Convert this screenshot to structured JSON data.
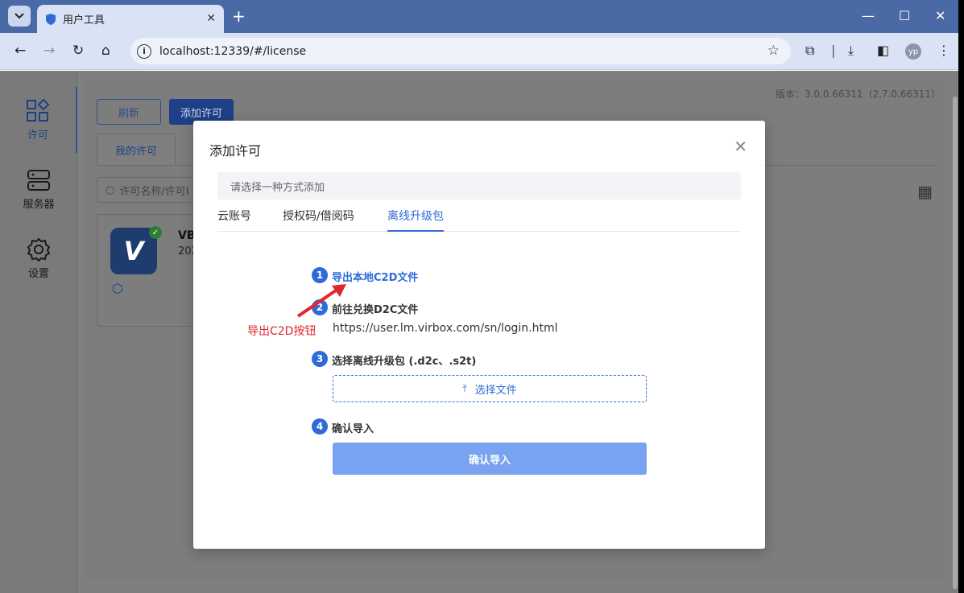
{
  "browser": {
    "tab_title": "用户工具",
    "url": "localhost:12339/#/license",
    "avatar_initials": "yp"
  },
  "sidebar": {
    "items": [
      {
        "label": "许可",
        "icon": "apps-grid-icon"
      },
      {
        "label": "服务器",
        "icon": "server-icon"
      },
      {
        "label": "设置",
        "icon": "gear-icon"
      }
    ]
  },
  "main": {
    "version": "版本：3.0.0.66311（2.7.0.66311）",
    "refresh_label": "刷新",
    "add_license_label": "添加许可",
    "tab_my_license": "我的许可",
    "search_placeholder": "许可名称/许可I",
    "card": {
      "name": "VB",
      "sub": "202",
      "logo_letter": "V"
    }
  },
  "modal": {
    "title": "添加许可",
    "banner": "请选择一种方式添加",
    "tabs": [
      "云账号",
      "授权码/借阅码",
      "离线升级包"
    ],
    "active_tab": "离线升级包",
    "steps": [
      {
        "num": "1",
        "label": "导出本地C2D文件"
      },
      {
        "num": "2",
        "label": "前往兑换D2C文件"
      },
      {
        "num": "3",
        "label": "选择离线升级包 (.d2c、.s2t)"
      },
      {
        "num": "4",
        "label": "确认导入"
      }
    ],
    "exchange_url": "https://user.lm.virbox.com/sn/login.html",
    "upload_label": "选择文件",
    "confirm_label": "确认导入"
  },
  "annotation": {
    "text": "导出C2D按钮",
    "color": "#e0262f"
  },
  "colors": {
    "accent": "#2f6bd8",
    "chrome": "#4a6aa6",
    "confirm_disabled": "#79a2f0"
  }
}
